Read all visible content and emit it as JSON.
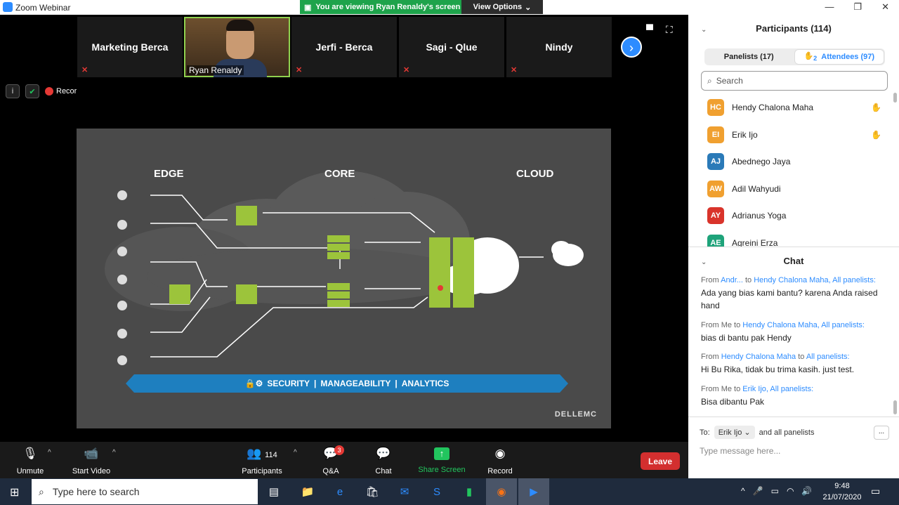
{
  "app": {
    "title": "Zoom Webinar"
  },
  "share_banner": {
    "viewing": "You are viewing Ryan Renaldy's screen",
    "view_options": "View Options"
  },
  "tiles": [
    {
      "name": "Marketing Berca"
    },
    {
      "name": "Ryan Renaldy"
    },
    {
      "name": "Jerfi - Berca"
    },
    {
      "name": "Sagi - Qlue"
    },
    {
      "name": "Nindy"
    }
  ],
  "status": {
    "recording": "Recording"
  },
  "slide": {
    "edge": "EDGE",
    "core": "CORE",
    "cloud": "CLOUD",
    "banner": {
      "security": "SECURITY",
      "sep1": "|",
      "manageability": "MANAGEABILITY",
      "sep2": "|",
      "analytics": "ANALYTICS"
    },
    "brand": "DELLEMC"
  },
  "toolbar": {
    "unmute": "Unmute",
    "start_video": "Start Video",
    "participants": "Participants",
    "participants_count": "114",
    "qa": "Q&A",
    "qa_badge": "3",
    "chat": "Chat",
    "share": "Share Screen",
    "record": "Record",
    "leave": "Leave"
  },
  "participants_panel": {
    "title": "Participants (114)",
    "tab_panelists": "Panelists (17)",
    "tab_attendees": "Attendees (97)",
    "attendee_hands": "2",
    "search_placeholder": "Search",
    "list": [
      {
        "initials": "HC",
        "name": "Hendy Chalona Maha",
        "color": "#f0a030",
        "hand": true
      },
      {
        "initials": "EI",
        "name": "Erik Ijo",
        "color": "#f0a030",
        "hand": true
      },
      {
        "initials": "AJ",
        "name": "Abednego Jaya",
        "color": "#2a7ab8",
        "hand": false
      },
      {
        "initials": "AW",
        "name": "Adil Wahyudi",
        "color": "#f0a030",
        "hand": false
      },
      {
        "initials": "AY",
        "name": "Adrianus Yoga",
        "color": "#d9342b",
        "hand": false
      },
      {
        "initials": "AE",
        "name": "Agreini Erza",
        "color": "#1ea37a",
        "hand": false
      }
    ]
  },
  "chat_panel": {
    "title": "Chat",
    "messages": [
      {
        "from": "From",
        "sender": "Andr...",
        "to": "to",
        "recipient": "Hendy Chalona Maha, All panelists:",
        "text": "Ada yang bias kami bantu? karena Anda raised hand"
      },
      {
        "from": "From Me to",
        "sender": "",
        "to": "",
        "recipient": "Hendy Chalona Maha, All panelists:",
        "text": "bias di bantu pak Hendy"
      },
      {
        "from": "From",
        "sender": "Hendy Chalona Maha",
        "to": "to",
        "recipient": "All panelists:",
        "text": "Hi Bu Rika, tidak bu trima kasih. just test."
      },
      {
        "from": "From Me to",
        "sender": "",
        "to": "",
        "recipient": "Erik Ijo, All panelists:",
        "text": "Bisa dibantu Pak"
      }
    ],
    "to_label": "To:",
    "to_value": "Erik Ijo",
    "to_suffix": "and all panelists",
    "more": "...",
    "input_placeholder": "Type message here..."
  },
  "taskbar": {
    "search_placeholder": "Type here to search",
    "time": "9:48",
    "date": "21/07/2020"
  }
}
